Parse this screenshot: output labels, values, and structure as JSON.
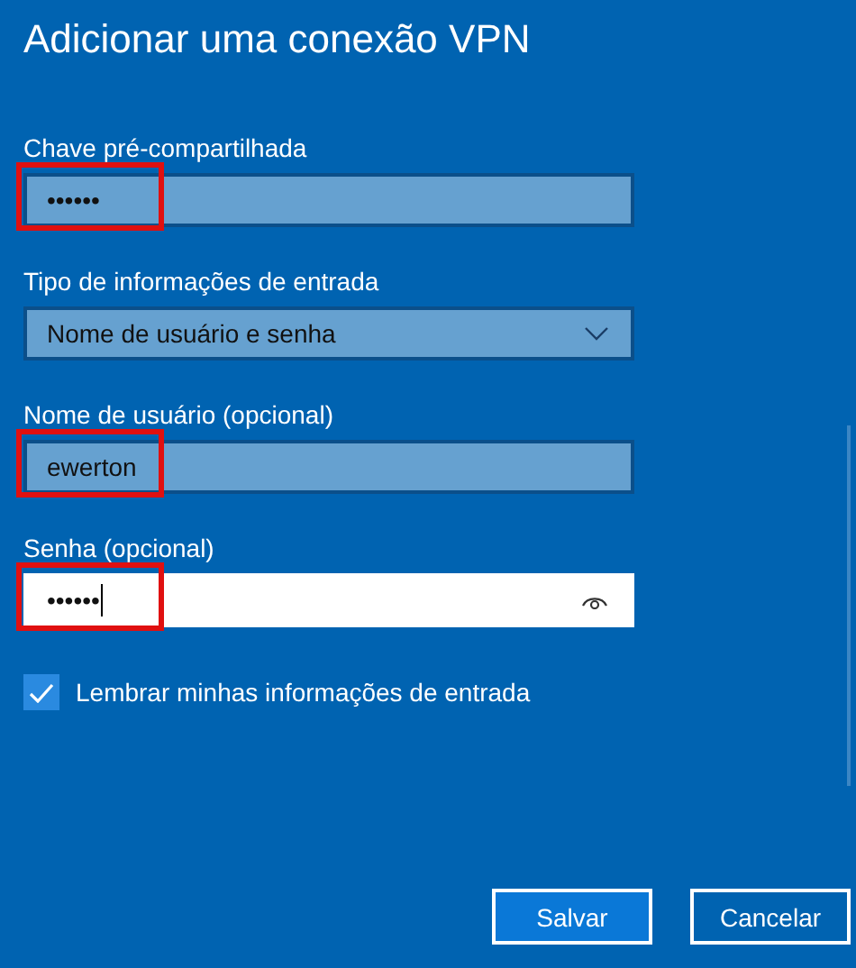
{
  "window": {
    "title": "Adicionar uma conexão VPN"
  },
  "fields": [
    {
      "kind": "text",
      "label": "Chave pré-compartilhada",
      "value": "••••••",
      "focused": false,
      "highlighted": true
    },
    {
      "kind": "dropdown",
      "label": "Tipo de informações de entrada",
      "value": "Nome de usuário e senha",
      "focused": false,
      "highlighted": false
    },
    {
      "kind": "text",
      "label": "Nome de usuário (opcional)",
      "value": "ewerton",
      "focused": false,
      "highlighted": true
    },
    {
      "kind": "password",
      "label": "Senha (opcional)",
      "value": "••••••",
      "focused": true,
      "highlighted": true
    }
  ],
  "checkbox": {
    "label": "Lembrar minhas informações de entrada",
    "checked": true
  },
  "buttons": [
    {
      "label": "Salvar",
      "kind": "primary"
    },
    {
      "label": "Cancelar",
      "kind": "secondary"
    }
  ]
}
